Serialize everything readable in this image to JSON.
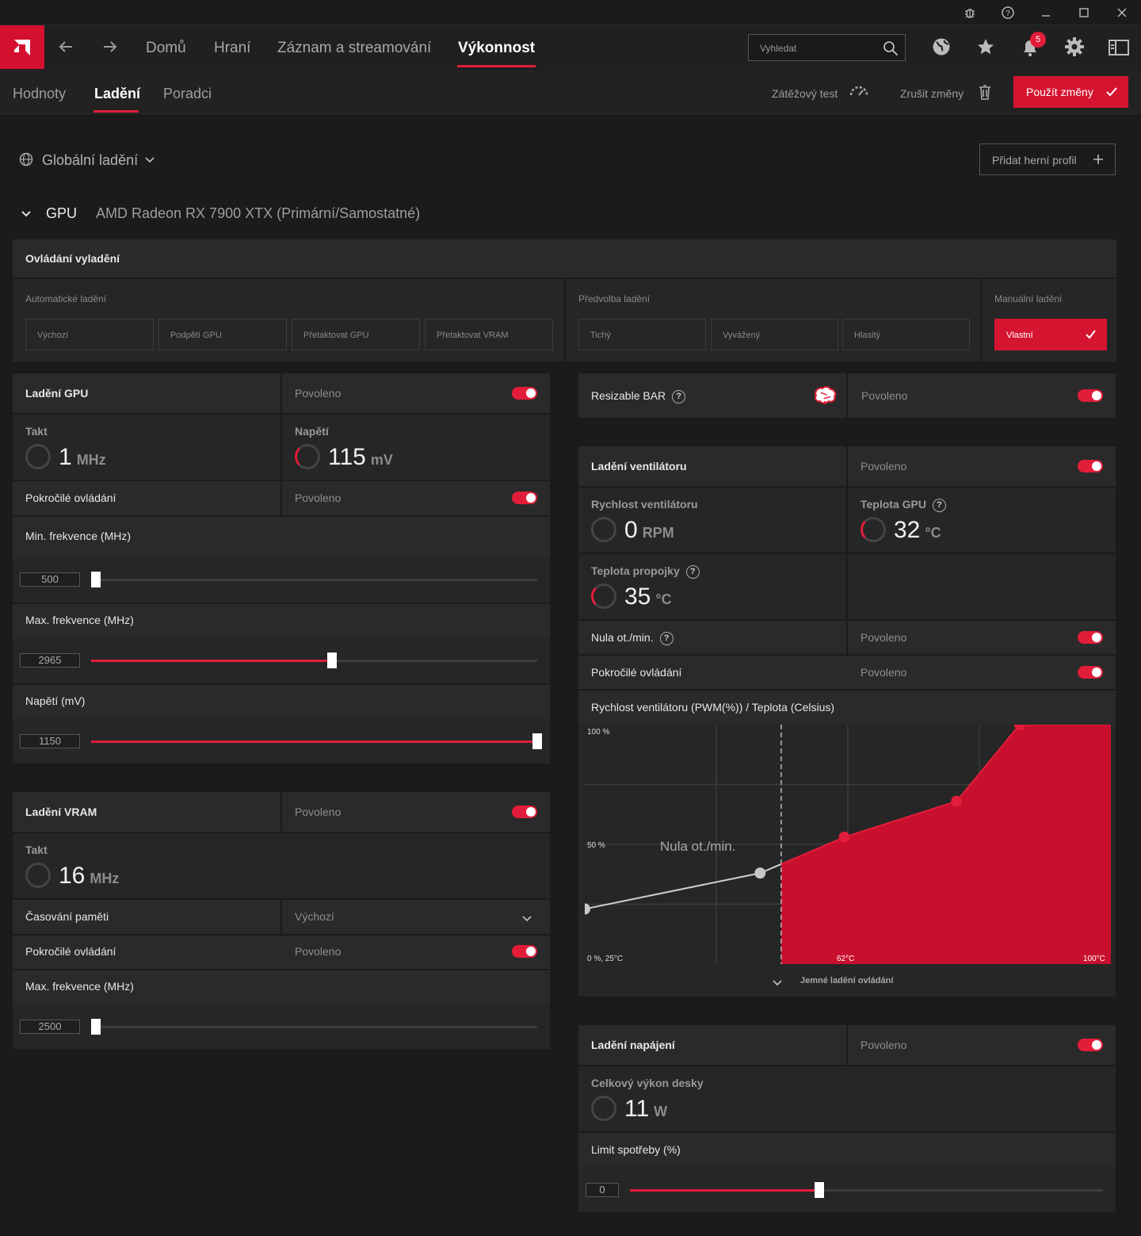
{
  "window": {
    "controls": [
      "bug-icon",
      "help-icon",
      "minimize-icon",
      "maximize-icon",
      "close-icon"
    ]
  },
  "nav": {
    "tabs": [
      "Domů",
      "Hraní",
      "Záznam a streamování",
      "Výkonnost"
    ],
    "active": "Výkonnost",
    "search_placeholder": "Vyhledat",
    "notifications": "5"
  },
  "subnav": {
    "tabs": [
      "Hodnoty",
      "Ladění",
      "Poradci"
    ],
    "active": "Ladění",
    "stress_test": "Zátěžový test",
    "discard": "Zrušit změny",
    "apply": "Použít změny"
  },
  "profile": {
    "label": "Globální ladění",
    "add_profile": "Přidat herní profil"
  },
  "gpu": {
    "label": "GPU",
    "name": "AMD Radeon RX 7900 XTX (Primární/Samostatné)"
  },
  "control": {
    "title": "Ovládání vyladění",
    "auto_label": "Automatické ladění",
    "auto_buttons": [
      "Výchozí",
      "Podpětí GPU",
      "Přetaktovat GPU",
      "Přetaktovat VRAM"
    ],
    "preset_label": "Předvolba ladění",
    "preset_buttons": [
      "Tichý",
      "Vyvážený",
      "Hlasitý"
    ],
    "manual_label": "Manuální ladění",
    "manual_button": "Vlastní"
  },
  "gpu_tuning": {
    "title": "Ladění GPU",
    "state": "Povoleno",
    "clock_label": "Takt",
    "clock_value": "1",
    "clock_unit": "MHz",
    "voltage_label": "Napětí",
    "voltage_value": "115",
    "voltage_unit": "mV",
    "advanced_label": "Pokročilé ovládání",
    "advanced_state": "Povoleno",
    "min_freq_label": "Min. frekvence (MHz)",
    "min_freq": "500",
    "min_freq_level": 0.0,
    "max_freq_label": "Max. frekvence (MHz)",
    "max_freq": "2965",
    "max_freq_level": 0.54,
    "voltage_mv_label": "Napětí (mV)",
    "voltage_mv": "1150",
    "voltage_mv_level": 1.0
  },
  "vram_tuning": {
    "title": "Ladění VRAM",
    "state": "Povoleno",
    "clock_label": "Takt",
    "clock_value": "16",
    "clock_unit": "MHz",
    "timing_label": "Časování paměti",
    "timing_value": "Výchozí",
    "advanced_label": "Pokročilé ovládání",
    "advanced_state": "Povoleno",
    "max_freq_label": "Max. frekvence (MHz)",
    "max_freq": "2500",
    "max_freq_level": 0.0
  },
  "rebar": {
    "label": "Resizable BAR",
    "state": "Povoleno"
  },
  "fan": {
    "title": "Ladění ventilátoru",
    "state": "Povoleno",
    "speed_label": "Rychlost ventilátoru",
    "speed_value": "0",
    "speed_unit": "RPM",
    "gpu_temp_label": "Teplota GPU",
    "gpu_temp": "32",
    "temp_unit": "°C",
    "junction_label": "Teplota propojky",
    "junction_temp": "35",
    "zero_rpm_label": "Nula ot./min.",
    "zero_rpm_state": "Povoleno",
    "advanced_label": "Pokročilé ovládání",
    "advanced_state": "Povoleno",
    "curve_title": "Rychlost ventilátoru (PWM(%)) / Teplota (Celsius)",
    "fine_tune": "Jemné ladění ovládání"
  },
  "chart_data": {
    "type": "line",
    "ylabel_top": "100 %",
    "ylabel_mid": "50 %",
    "origin_label": "0 %, 25°C",
    "x_mark_label": "62°C",
    "x_max_label": "100°C",
    "zero_rpm_annotation": "Nula ot./min.",
    "xlim": [
      25,
      100
    ],
    "ylim": [
      0,
      100
    ],
    "zero_rpm_threshold_temp": 53,
    "points": [
      {
        "x": 25,
        "y": 23
      },
      {
        "x": 50,
        "y": 38
      },
      {
        "x": 62,
        "y": 53
      },
      {
        "x": 78,
        "y": 68
      },
      {
        "x": 87,
        "y": 100
      }
    ]
  },
  "power": {
    "title": "Ladění napájení",
    "state": "Povoleno",
    "board_power_label": "Celkový výkon desky",
    "board_power": "11",
    "board_power_unit": "W",
    "limit_label": "Limit spotřeby (%)",
    "limit_value": "0",
    "limit_level": 0.4
  }
}
